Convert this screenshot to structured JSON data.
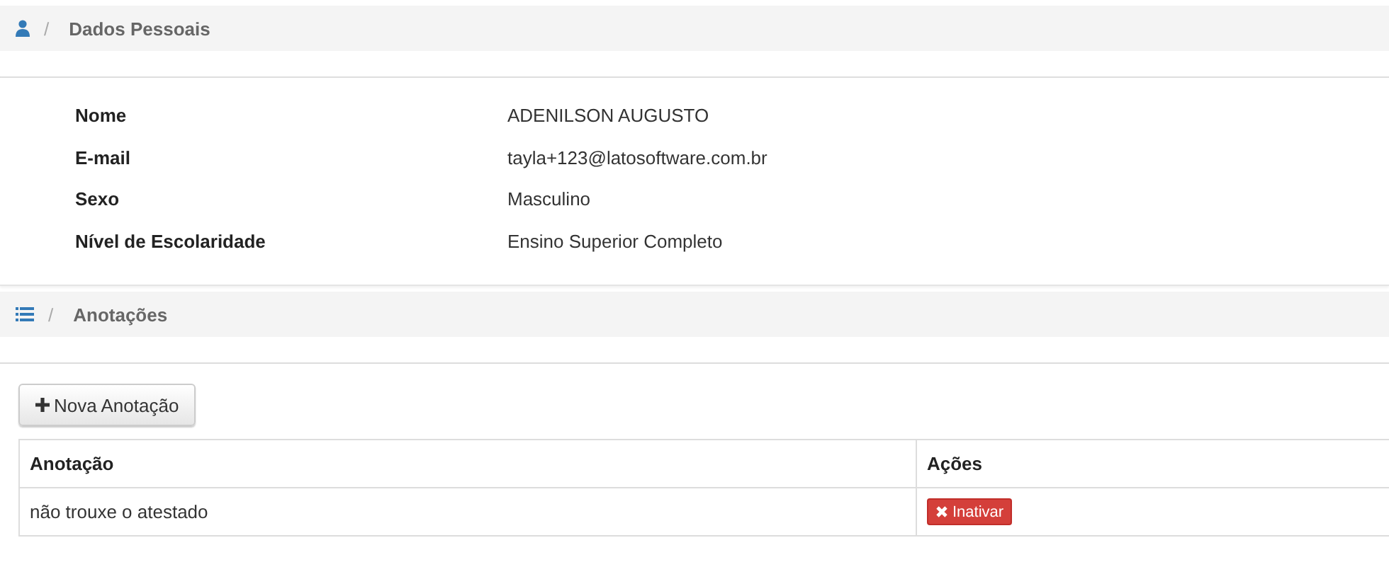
{
  "personal": {
    "header": {
      "kind": "person",
      "separator": "/",
      "title": "Dados Pessoais"
    },
    "fields": [
      {
        "label": "Nome",
        "value": "ADENILSON AUGUSTO"
      },
      {
        "label": "E-mail",
        "value": "tayla+123@latosoftware.com.br"
      },
      {
        "label": "Sexo",
        "value": "Masculino"
      },
      {
        "label": "Nível de Escolaridade",
        "value": "Ensino Superior Completo"
      }
    ]
  },
  "notes": {
    "header": {
      "kind": "list",
      "separator": "/",
      "title": "Anotações"
    },
    "new_button": "Nova Anotação",
    "table": {
      "columns": [
        "Anotação",
        "Ações"
      ],
      "rows": [
        {
          "note": "não trouxe o atestado",
          "action": "Inativar"
        }
      ]
    }
  }
}
